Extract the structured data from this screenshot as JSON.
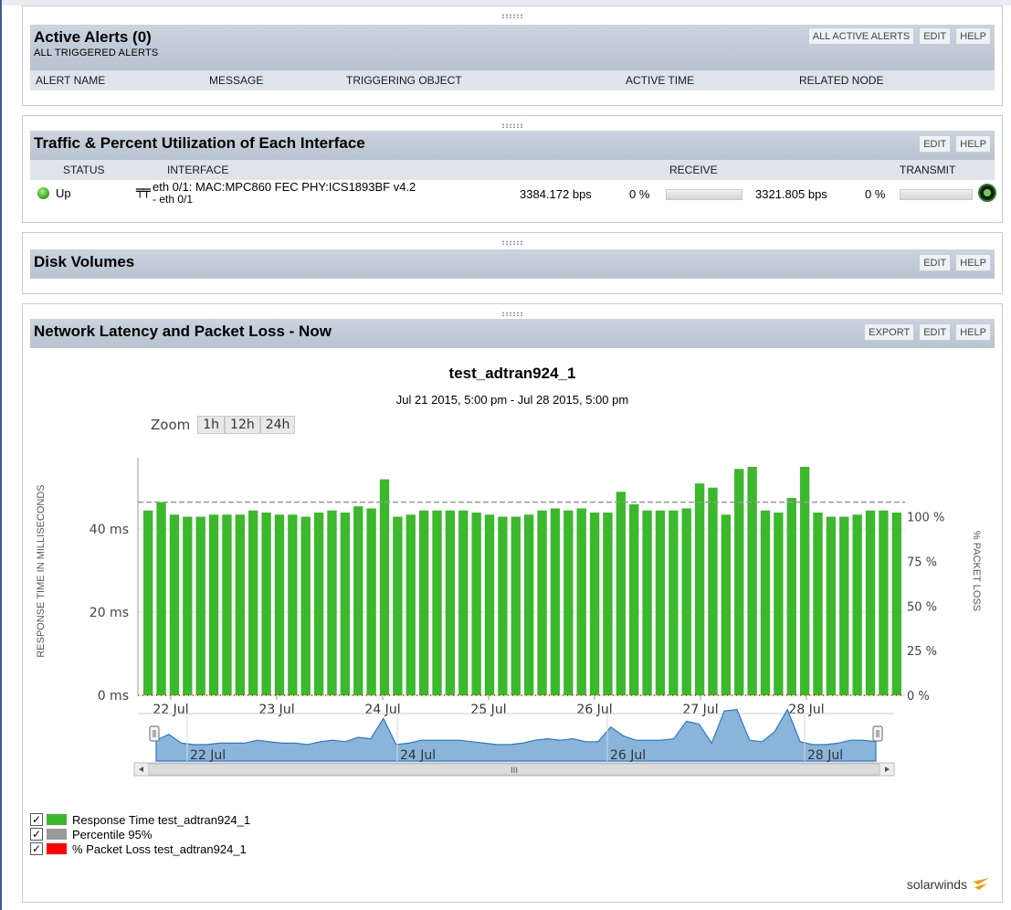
{
  "alerts": {
    "title": "Active Alerts (0)",
    "subtitle": "ALL TRIGGERED ALERTS",
    "buttons": [
      "ALL ACTIVE ALERTS",
      "EDIT",
      "HELP"
    ],
    "columns": [
      "ALERT NAME",
      "MESSAGE",
      "TRIGGERING OBJECT",
      "ACTIVE TIME",
      "RELATED NODE"
    ]
  },
  "traffic": {
    "title": "Traffic & Percent Utilization of Each Interface",
    "buttons": [
      "EDIT",
      "HELP"
    ],
    "columns": [
      "STATUS",
      "INTERFACE",
      "RECEIVE",
      "TRANSMIT"
    ],
    "row": {
      "status": "Up",
      "interface_line1": "eth 0/1: MAC:MPC860 FEC PHY:ICS1893BF v4.2",
      "interface_line2": "- eth 0/1",
      "receive_bps": "3384.172 bps",
      "receive_pct": "0 %",
      "transmit_bps": "3321.805 bps",
      "transmit_pct": "0 %",
      "receive_util": 0,
      "transmit_util": 0
    },
    "status_color": "#3bb82c"
  },
  "disk": {
    "title": "Disk Volumes",
    "buttons": [
      "EDIT",
      "HELP"
    ]
  },
  "latency": {
    "title": "Network Latency and Packet Loss - Now",
    "buttons": [
      "EXPORT",
      "EDIT",
      "HELP"
    ],
    "zoom_label": "Zoom",
    "zoom_options": [
      "1h",
      "12h",
      "24h"
    ],
    "legend": [
      {
        "label": "Response Time test_adtran924_1",
        "color": "#3bb82c",
        "checked": true
      },
      {
        "label": "Percentile 95%",
        "color": "#999999",
        "checked": true
      },
      {
        "label": "% Packet Loss test_adtran924_1",
        "color": "#ff0000",
        "checked": true
      }
    ],
    "brand": "solarwinds"
  },
  "chart_data": {
    "type": "bar",
    "title": "test_adtran924_1",
    "subtitle": "Jul 21 2015, 5:00 pm - Jul 28 2015, 5:00 pm",
    "ylabel": "RESPONSE TIME IN MILLISECONDS",
    "y2label": "% PACKET LOSS",
    "y_ticks": [
      "0 ms",
      "20 ms",
      "40 ms"
    ],
    "y2_ticks": [
      "0 %",
      "25 %",
      "50 %",
      "75 %",
      "100 %"
    ],
    "x_ticks": [
      "22 Jul",
      "23 Jul",
      "24 Jul",
      "25 Jul",
      "26 Jul",
      "27 Jul",
      "28 Jul"
    ],
    "ylim": [
      0,
      55
    ],
    "y2lim": [
      0,
      128
    ],
    "percentile_95": 46.5,
    "series": [
      {
        "name": "Response Time test_adtran924_1",
        "color": "#3bb82c",
        "values": [
          44.5,
          46.5,
          43.5,
          43,
          43,
          43.5,
          43.5,
          43.5,
          44.5,
          44,
          43.5,
          43.5,
          43,
          44,
          44.5,
          44,
          45.5,
          45,
          52,
          43,
          43.5,
          44.5,
          44.5,
          44.5,
          44.5,
          44,
          43.5,
          43,
          43,
          43.5,
          44.5,
          45,
          44.5,
          45,
          44,
          44,
          49,
          46,
          44.5,
          44.5,
          44.5,
          45,
          51,
          50,
          43.5,
          54.5,
          55,
          44.5,
          44,
          47.5,
          55,
          44,
          43,
          43,
          43.5,
          44.5,
          44.5,
          44
        ]
      },
      {
        "name": "% Packet Loss test_adtran924_1",
        "color": "#ff0000",
        "values": [
          0
        ]
      }
    ],
    "navigator": {
      "x_ticks": [
        "22 Jul",
        "24 Jul",
        "26 Jul",
        "28 Jul"
      ],
      "scrollbar_label": "III"
    }
  }
}
